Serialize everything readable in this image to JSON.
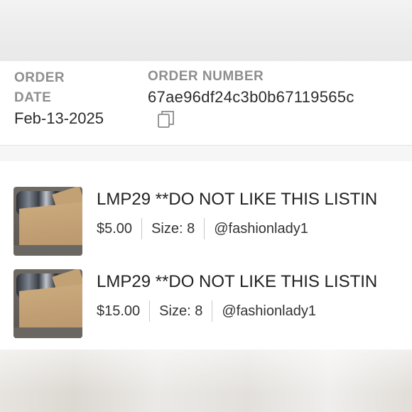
{
  "order": {
    "date_label": "ORDER DATE",
    "date_value": "Feb-13-2025",
    "number_label": "ORDER NUMBER",
    "number_value": "67ae96df24c3b0b67119565c",
    "copy_icon": "copy-icon"
  },
  "items": [
    {
      "title": "LMP29 **DO NOT LIKE THIS LISTIN",
      "price": "$5.00",
      "size": "Size: 8",
      "seller": "@fashionlady1"
    },
    {
      "title": "LMP29 **DO NOT LIKE THIS LISTIN",
      "price": "$15.00",
      "size": "Size: 8",
      "seller": "@fashionlady1"
    }
  ]
}
